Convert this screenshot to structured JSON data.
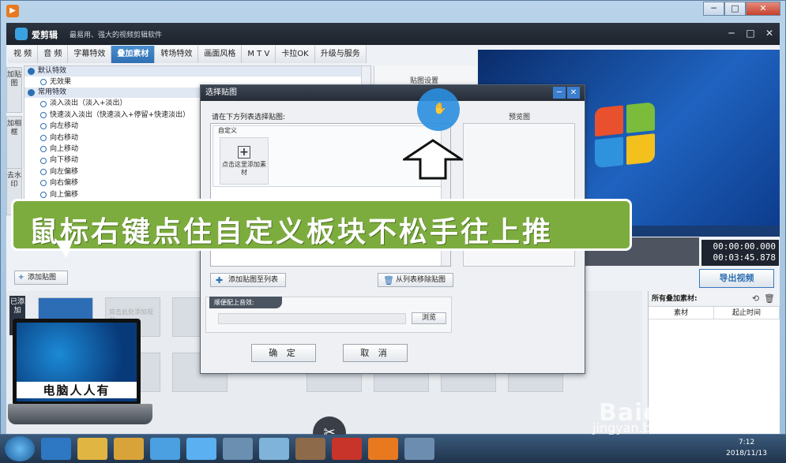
{
  "window": {
    "app_name": "爱剪辑",
    "slogan": "最易用、强大的视频剪辑软件",
    "ctrl_min": "─",
    "ctrl_max": "□",
    "ctrl_close": "✕"
  },
  "tabs": [
    "视 频",
    "音 频",
    "字幕特效",
    "叠加素材",
    "转场特效",
    "画面风格",
    "M T V",
    "卡拉OK",
    "升级与服务"
  ],
  "active_tab": "叠加素材",
  "side_tabs": [
    "加贴图",
    "加相框",
    "去水印"
  ],
  "effects": {
    "groups": [
      "默认特效",
      "常用特效"
    ],
    "items": [
      "无效果",
      "淡入淡出（淡入+淡出）",
      "快速淡入淡出（快速淡入+停留+快速淡出）",
      "向左移动",
      "向右移动",
      "向上移动",
      "向下移动",
      "向左偏移",
      "向右偏移",
      "向上偏移"
    ]
  },
  "sticker_settings_label": "贴图设置",
  "add_sticker_button": "添加贴图",
  "time": {
    "current": "00:00:00.000",
    "total": "00:03:45.878"
  },
  "export_button": "导出视频",
  "timeline": {
    "label": "已添加",
    "placeholder": "双击此处添加视频"
  },
  "material_panel": {
    "title": "所有叠加素材:",
    "col_material": "素材",
    "col_time": "起止时间"
  },
  "dialog": {
    "title": "选择贴图",
    "hint": "请在下方列表选择贴图:",
    "preview_label": "预览图",
    "custom_label": "自定义",
    "add_material": "点击这里添加素材",
    "add_to_list": "添加贴图至列表",
    "remove_from_list": "从列表移除贴图",
    "sound_label": "顺便配上音效:",
    "browse": "浏览",
    "ok": "确 定",
    "cancel": "取 消"
  },
  "banner_text": "鼠标右键点住自定义板块不松手往上推",
  "laptop_caption": "电脑人人有",
  "watermark": "Baidu经验",
  "watermark_url": "jingyan.baidu.com",
  "taskbar": {
    "time": "7:12",
    "date": "2018/11/13"
  },
  "colors": {
    "accent": "#2e6fb2",
    "banner": "#7cac3e",
    "titlebar": "#262d38"
  }
}
